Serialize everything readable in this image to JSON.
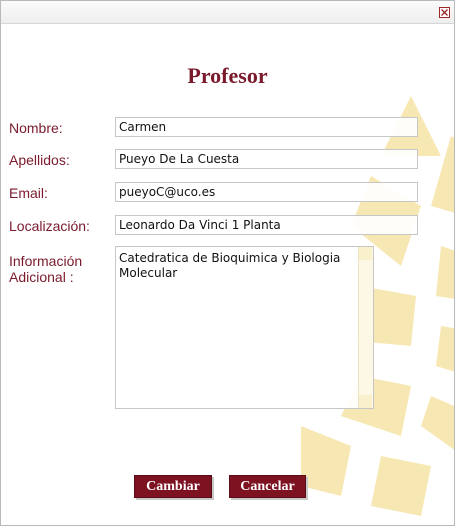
{
  "window": {
    "close_icon": "close-icon"
  },
  "form": {
    "title": "Profesor",
    "fields": [
      {
        "label": "Nombre:",
        "value": "Carmen"
      },
      {
        "label": "Apellidos:",
        "value": "Pueyo De La Cuesta"
      },
      {
        "label": "Email:",
        "value": "pueyoC@uco.es"
      },
      {
        "label": "Localización:",
        "value": "Leonardo Da Vinci 1 Planta"
      }
    ],
    "extra": {
      "label_line1": "Información",
      "label_line2": "Adicional :",
      "value": "Catedratica de Bioquimica y Biologia Molecular"
    }
  },
  "buttons": {
    "save_label": "Cambiar",
    "cancel_label": "Cancelar"
  },
  "colors": {
    "accent": "#7a1a2c",
    "button_bg": "#7d1221",
    "watermark": "#f6e6b0"
  }
}
